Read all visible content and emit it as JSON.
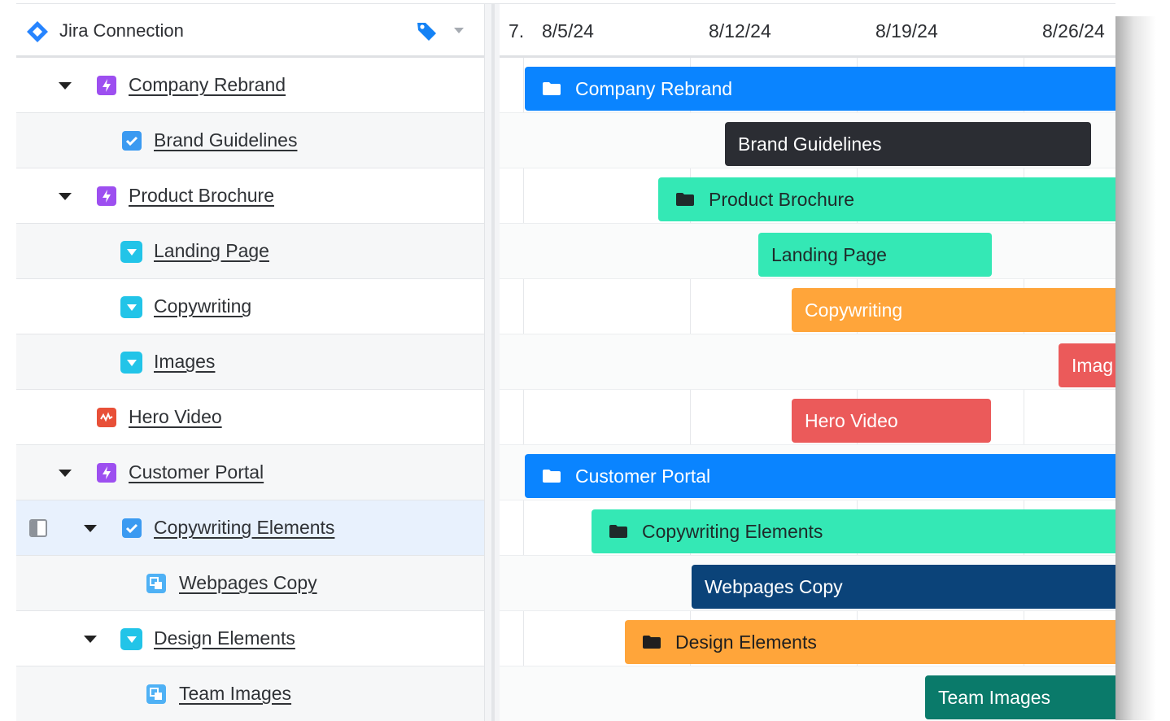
{
  "header": {
    "connection_title": "Jira Connection",
    "dates": [
      "7.",
      "8/5/24",
      "8/12/24",
      "8/19/24",
      "8/26/24"
    ]
  },
  "colors": {
    "blue": "#0a84ff",
    "dark": "#2b2d33",
    "mint": "#34e8b5",
    "orange": "#ffa53a",
    "red": "#eb5a5a",
    "navy": "#0b4379",
    "teal": "#0a7a6a",
    "epic_purple": "#9d4ff0",
    "story_cyan": "#22c4e8",
    "task_blue": "#3b9af1",
    "subtask_blue": "#4fb1f5",
    "bug_red": "#e85038"
  },
  "rows": [
    {
      "label": "Company Rebrand",
      "type": "epic-icon",
      "bar_label": "Company Rebrand"
    },
    {
      "label": "Brand Guidelines",
      "type": "task-icon",
      "bar_label": "Brand Guidelines"
    },
    {
      "label": "Product Brochure",
      "type": "epic-icon",
      "bar_label": "Product Brochure"
    },
    {
      "label": "Landing Page",
      "type": "story-icon",
      "bar_label": "Landing Page"
    },
    {
      "label": "Copywriting",
      "type": "story-icon",
      "bar_label": "Copywriting"
    },
    {
      "label": "Images",
      "type": "story-icon",
      "bar_label": "Imag"
    },
    {
      "label": "Hero Video",
      "type": "bug-icon",
      "bar_label": "Hero Video"
    },
    {
      "label": "Customer Portal",
      "type": "epic-icon",
      "bar_label": "Customer Portal"
    },
    {
      "label": "Copywriting Elements",
      "type": "task-icon",
      "bar_label": "Copywriting Elements"
    },
    {
      "label": "Webpages Copy",
      "type": "subtask-icon",
      "bar_label": "Webpages Copy"
    },
    {
      "label": "Design Elements",
      "type": "story-icon",
      "bar_label": "Design Elements"
    },
    {
      "label": "Team Images",
      "type": "subtask-icon",
      "bar_label": "Team Images"
    }
  ]
}
